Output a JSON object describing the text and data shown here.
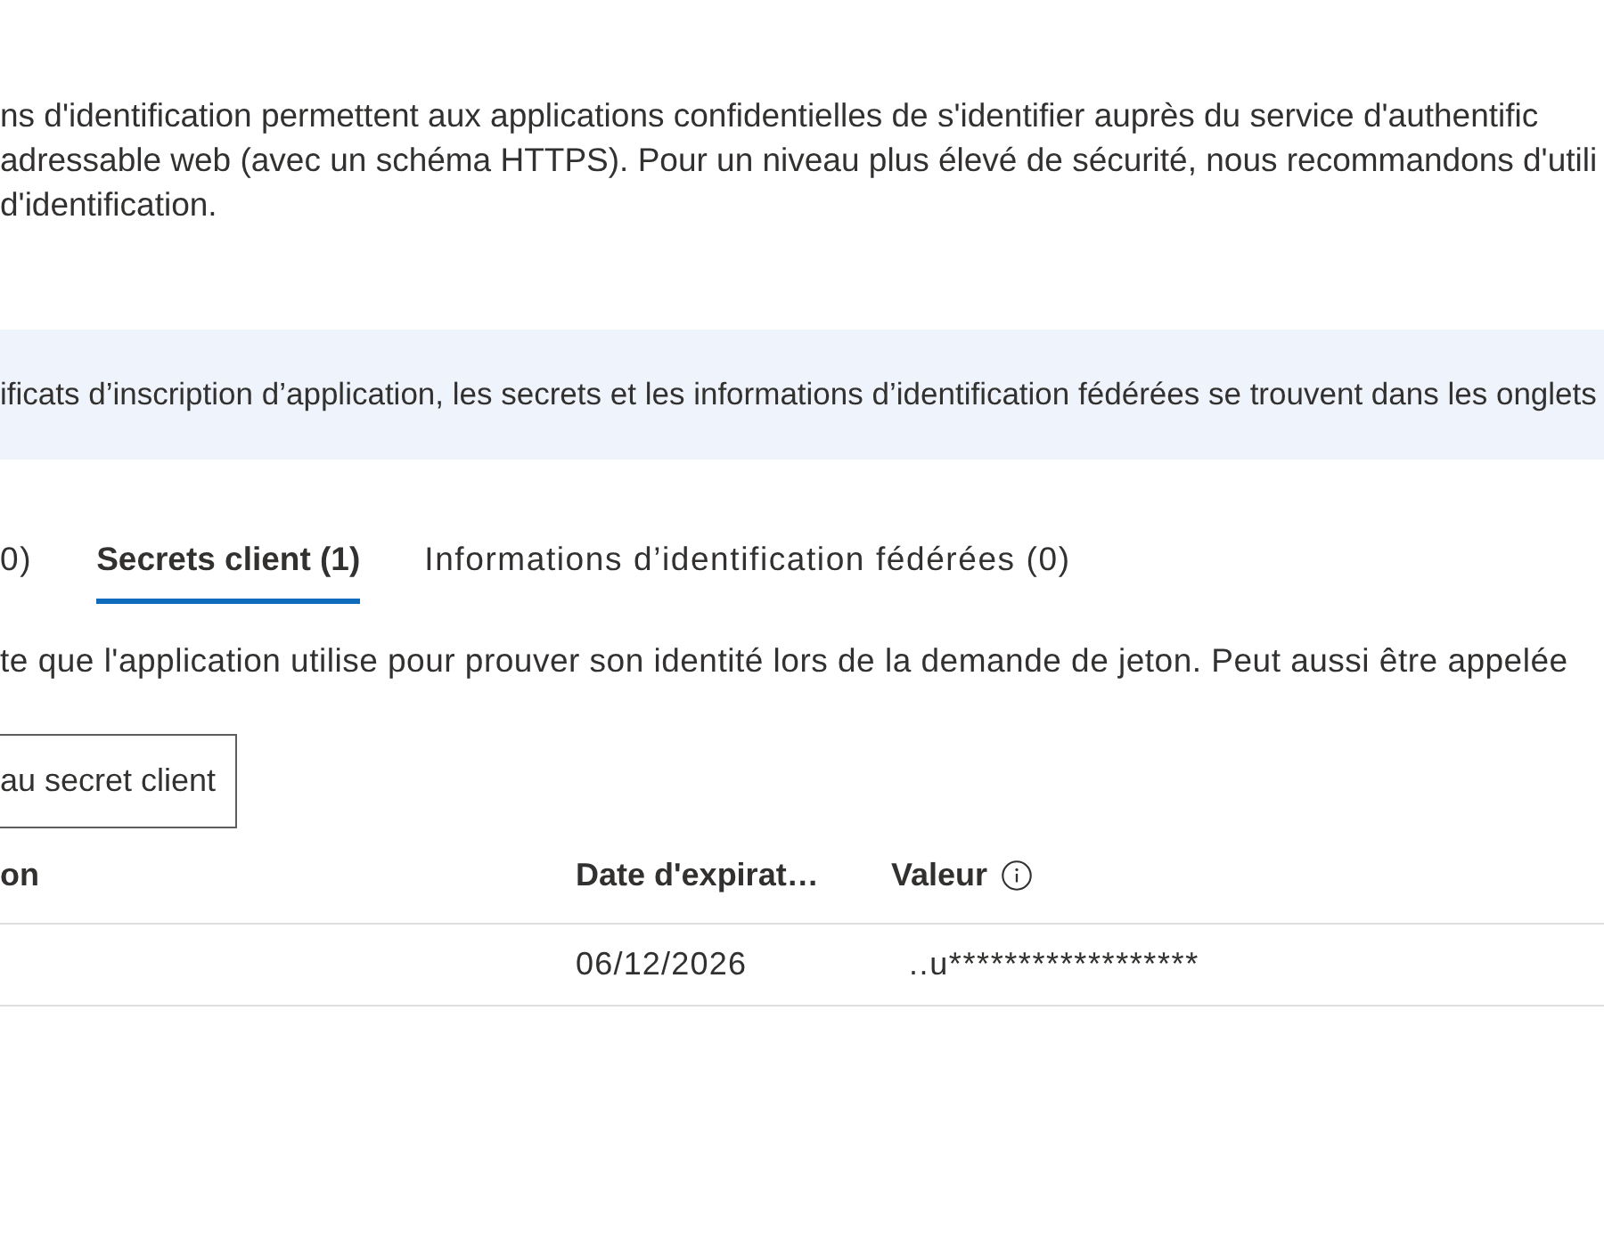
{
  "description_lines": [
    "ns d'identification permettent aux applications confidentielles de s'identifier auprès du service d'authentific",
    "adressable web (avec un schéma HTTPS). Pour un niveau plus élevé de sécurité, nous recommandons d'utili",
    "d'identification."
  ],
  "info_banner": {
    "text": "ificats d’inscription d’application, les secrets et les informations d’identification fédérées se trouvent dans les onglets"
  },
  "tabs": [
    {
      "label": "0)",
      "selected": false
    },
    {
      "label": "Secrets client (1)",
      "selected": true
    },
    {
      "label": "Informations d’identification fédérées (0)",
      "selected": false
    }
  ],
  "tab_description": "te que l'application utilise pour prouver son identité lors de la demande de jeton. Peut aussi être appelée",
  "add_button": {
    "label": "au secret client"
  },
  "table": {
    "columns": [
      {
        "label": "on",
        "info_icon": false
      },
      {
        "label": "Date d'expirat…",
        "info_icon": false
      },
      {
        "label": "Valeur",
        "info_icon": true
      }
    ],
    "rows": [
      {
        "expiration_date": "06/12/2026",
        "value": "..u******************"
      }
    ]
  }
}
